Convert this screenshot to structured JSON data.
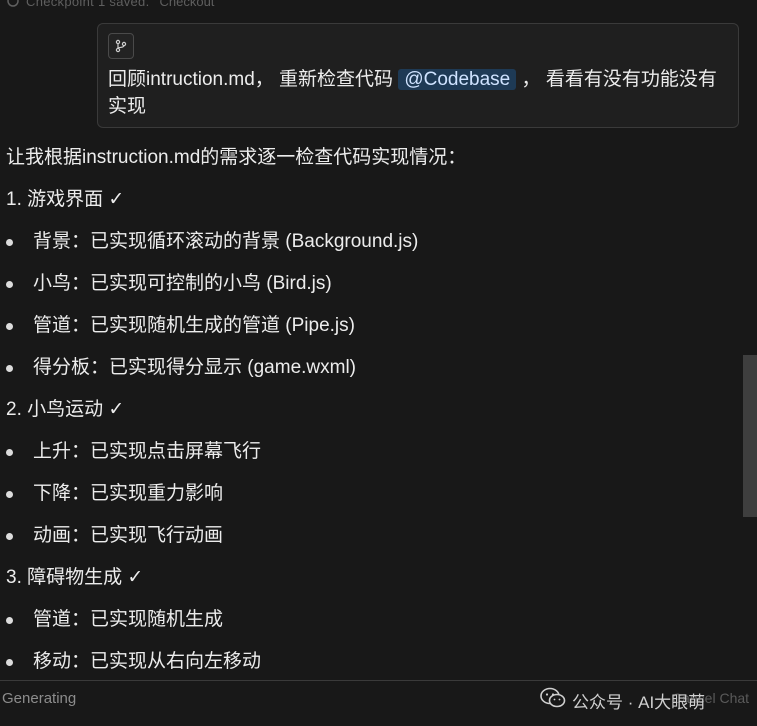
{
  "checkpoint": {
    "label": "Checkpoint 1 saved.",
    "action": "Checkout"
  },
  "prompt": {
    "text_before": "回顾intruction.md，  重新检查代码",
    "mention": "@Codebase",
    "text_after": "，  看看有没有功能没有",
    "text_line2": "实现"
  },
  "response": {
    "intro": "让我根据instruction.md的需求逐一检查代码实现情况：",
    "sections": [
      {
        "heading": "1. 游戏界面 ✓",
        "items": [
          "背景：已实现循环滚动的背景 (Background.js)",
          "小鸟：已实现可控制的小鸟 (Bird.js)",
          "管道：已实现随机生成的管道 (Pipe.js)",
          "得分板：已实现得分显示 (game.wxml)"
        ]
      },
      {
        "heading": "2. 小鸟运动 ✓",
        "items": [
          "上升：已实现点击屏幕飞行",
          "下降：已实现重力影响",
          "动画：已实现飞行动画"
        ]
      },
      {
        "heading": "3. 障碍物生成 ✓",
        "items": [
          "管道：已实现随机生成",
          "移动：已实现从右向左移动"
        ]
      }
    ]
  },
  "status": {
    "generating": "Generating",
    "hidden_button": "Cancel Chat"
  },
  "watermark": {
    "text": "公众号 · AI大眼萌"
  },
  "colors": {
    "background": "#181818",
    "mention_bg": "#1e3a55",
    "text": "#ececec"
  }
}
